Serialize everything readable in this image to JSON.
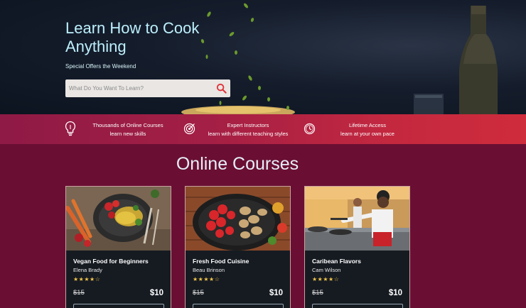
{
  "hero": {
    "title": "Learn How to Cook Anything",
    "subtitle": "Special Offers the Weekend",
    "search_placeholder": "What Do You Want To Learn?"
  },
  "features": [
    {
      "icon": "lightbulb-icon",
      "line1": "Thousands of Online Courses",
      "line2": "learn new skills"
    },
    {
      "icon": "target-icon",
      "line1": "Expert Instructors",
      "line2": "learn with different teaching styles"
    },
    {
      "icon": "clock-icon",
      "line1": "Lifetime Access",
      "line2": "learn at your own pace"
    }
  ],
  "courses": {
    "title": "Online Courses",
    "items": [
      {
        "title": "Vegan Food for Beginners",
        "author": "Elena Brady",
        "rating": 4.5,
        "stars": "★★★★☆",
        "old_price": "$15",
        "price": "$10"
      },
      {
        "title": "Fresh Food Cuisine",
        "author": "Beau Brinson",
        "rating": 4.5,
        "stars": "★★★★☆",
        "old_price": "$15",
        "price": "$10"
      },
      {
        "title": "Caribean Flavors",
        "author": "Cam Wilson",
        "rating": 4.5,
        "stars": "★★★★☆",
        "old_price": "$15",
        "price": "$10"
      }
    ]
  },
  "colors": {
    "accent_bar_start": "#8e1a45",
    "accent_bar_end": "#cf2c3c",
    "page_background": "#6a0f33",
    "card_background": "#161b22",
    "search_icon": "#e0333a",
    "star": "#f1c44a"
  }
}
